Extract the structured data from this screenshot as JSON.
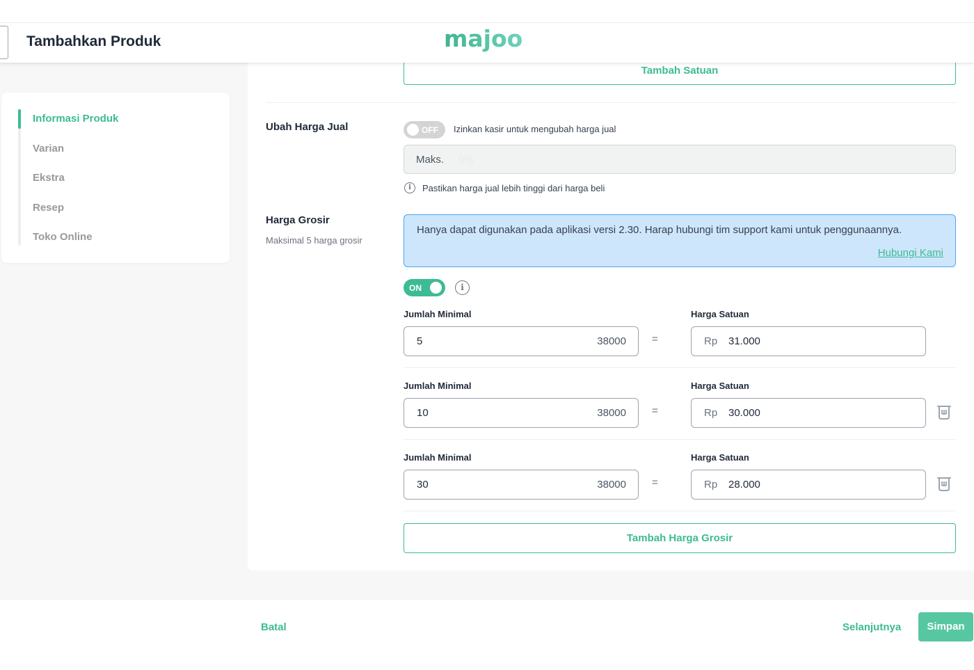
{
  "header": {
    "title": "Tambahkan Produk",
    "logo_text": "majoo"
  },
  "sidebar": {
    "items": [
      {
        "label": "Informasi Produk",
        "active": true
      },
      {
        "label": "Varian",
        "active": false
      },
      {
        "label": "Ekstra",
        "active": false
      },
      {
        "label": "Resep",
        "active": false
      },
      {
        "label": "Toko Online",
        "active": false
      }
    ]
  },
  "form": {
    "add_unit_button": "Tambah Satuan",
    "change_price": {
      "title": "Ubah Harga Jual",
      "toggle_state": "OFF",
      "toggle_desc": "Izinkan kasir untuk mengubah harga jual",
      "max_prefix": "Maks.",
      "max_placeholder": "0%",
      "hint": "Pastikan harga jual lebih tinggi dari harga beli"
    },
    "wholesale": {
      "title": "Harga Grosir",
      "subtitle": "Maksimal 5 harga grosir",
      "banner_text": "Hanya dapat digunakan pada aplikasi versi 2.30. Harap hubungi tim support kami untuk penggunaannya.",
      "banner_link": "Hubungi Kami",
      "toggle_state": "ON",
      "min_qty_label": "Jumlah Minimal",
      "unit_price_label": "Harga Satuan",
      "currency": "Rp",
      "equals": "=",
      "tiers": [
        {
          "qty": "5",
          "unit": "38000",
          "price": "31.000"
        },
        {
          "qty": "10",
          "unit": "38000",
          "price": "30.000"
        },
        {
          "qty": "30",
          "unit": "38000",
          "price": "28.000"
        }
      ],
      "add_button": "Tambah Harga Grosir"
    }
  },
  "footer": {
    "cancel": "Batal",
    "next": "Selanjutnya",
    "save": "Simpan"
  },
  "colors": {
    "accent": "#3dbb94",
    "banner_bg": "#cde6fb",
    "banner_border": "#4ea3f1"
  },
  "icons": [
    "trash-icon",
    "info-circle-icon"
  ]
}
